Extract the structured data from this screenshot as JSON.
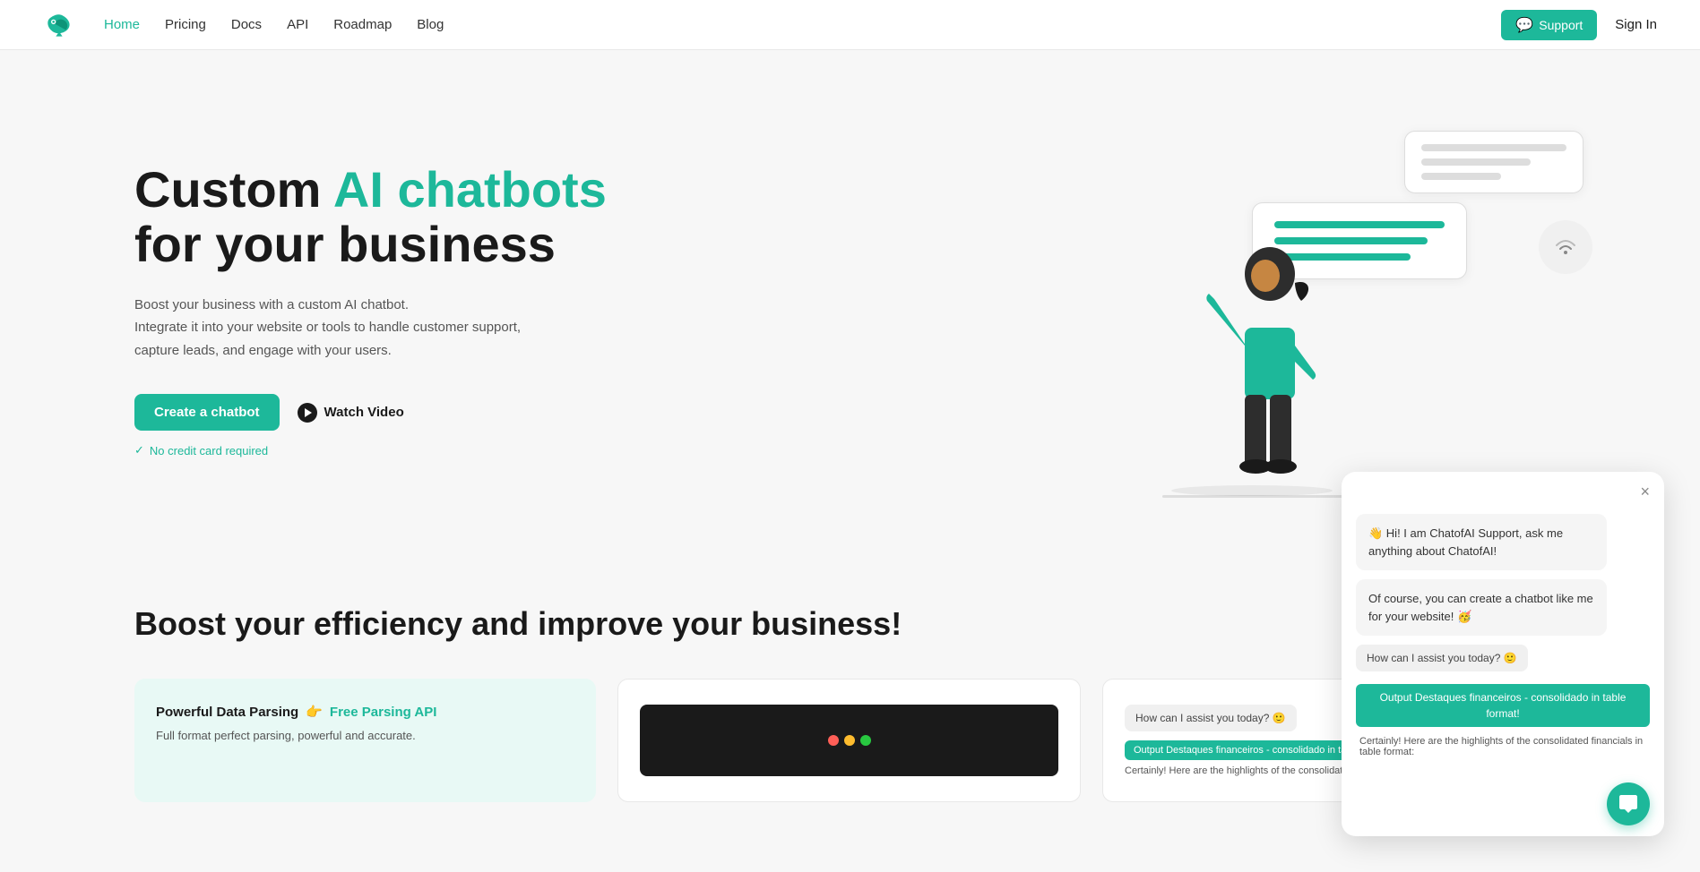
{
  "nav": {
    "links": [
      {
        "label": "Home",
        "active": true
      },
      {
        "label": "Pricing",
        "active": false
      },
      {
        "label": "Docs",
        "active": false
      },
      {
        "label": "API",
        "active": false
      },
      {
        "label": "Roadmap",
        "active": false
      },
      {
        "label": "Blog",
        "active": false
      }
    ],
    "support_label": "Support",
    "signin_label": "Sign In"
  },
  "hero": {
    "title_part1": "Custom ",
    "title_highlight": "AI chatbots",
    "title_part2": "for your business",
    "subtitle": "Boost your business with a custom AI chatbot.\nIntegrate it into your website or tools to handle customer support,\ncapture leads, and engage with your users.",
    "cta_label": "Create a chatbot",
    "watch_label": "Watch Video",
    "no_cc": "No credit card required"
  },
  "section2": {
    "title": "Boost your efficiency and improve your business!",
    "cards": [
      {
        "title_plain": "Powerful Data Parsing",
        "title_emoji": "👉",
        "title_link": "Free Parsing API",
        "desc": "Full format perfect parsing, powerful and accurate.",
        "teal_light": true
      }
    ]
  },
  "chat_widget": {
    "close_label": "×",
    "msg1": "👋 Hi! I am ChatofAI Support, ask me anything about ChatofAI!",
    "msg2": "Of course, you can create a chatbot like me for your website! 🥳",
    "how_can": "How can I assist you today? 🙂",
    "highlight_label": "Output Destaques financeiros - consolidado in table format!",
    "small_msg": "Certainly! Here are the highlights of the consolidated financials in table format:"
  }
}
